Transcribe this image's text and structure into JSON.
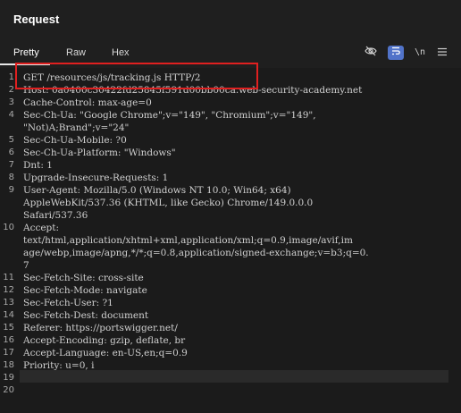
{
  "panel": {
    "title": "Request"
  },
  "tabs": [
    {
      "label": "Pretty"
    },
    {
      "label": "Raw"
    },
    {
      "label": "Hex"
    }
  ],
  "toolbar": {
    "hide_icon": "eye-slash-icon",
    "wrap_icon": "word-wrap-icon",
    "newline_label": "\\n",
    "menu_icon": "hamburger-menu-icon"
  },
  "lines": [
    {
      "n": "1",
      "text": "GET /resources/js/tracking.js HTTP/2"
    },
    {
      "n": "2",
      "text": "Host: 0a0400c30422fd25845f591d00bb00ca.web-security-academy.net"
    },
    {
      "n": "3",
      "text": "Cache-Control: max-age=0"
    },
    {
      "n": "4",
      "text": "Sec-Ch-Ua: \"Google Chrome\";v=\"149\", \"Chromium\";v=\"149\","
    },
    {
      "n": "",
      "text": "\"Not)A;Brand\";v=\"24\""
    },
    {
      "n": "5",
      "text": "Sec-Ch-Ua-Mobile: ?0"
    },
    {
      "n": "6",
      "text": "Sec-Ch-Ua-Platform: \"Windows\""
    },
    {
      "n": "7",
      "text": "Dnt: 1"
    },
    {
      "n": "8",
      "text": "Upgrade-Insecure-Requests: 1"
    },
    {
      "n": "9",
      "text": "User-Agent: Mozilla/5.0 (Windows NT 10.0; Win64; x64)"
    },
    {
      "n": "",
      "text": "AppleWebKit/537.36 (KHTML, like Gecko) Chrome/149.0.0.0"
    },
    {
      "n": "",
      "text": "Safari/537.36"
    },
    {
      "n": "10",
      "text": "Accept:"
    },
    {
      "n": "",
      "text": "text/html,application/xhtml+xml,application/xml;q=0.9,image/avif,im"
    },
    {
      "n": "",
      "text": "age/webp,image/apng,*/*;q=0.8,application/signed-exchange;v=b3;q=0."
    },
    {
      "n": "",
      "text": "7"
    },
    {
      "n": "11",
      "text": "Sec-Fetch-Site: cross-site"
    },
    {
      "n": "12",
      "text": "Sec-Fetch-Mode: navigate"
    },
    {
      "n": "13",
      "text": "Sec-Fetch-User: ?1"
    },
    {
      "n": "14",
      "text": "Sec-Fetch-Dest: document"
    },
    {
      "n": "15",
      "text": "Referer: https://portswigger.net/"
    },
    {
      "n": "16",
      "text": "Accept-Encoding: gzip, deflate, br"
    },
    {
      "n": "17",
      "text": "Accept-Language: en-US,en;q=0.9"
    },
    {
      "n": "18",
      "text": "Priority: u=0, i"
    },
    {
      "n": "19",
      "text": ""
    },
    {
      "n": "20",
      "text": ""
    }
  ],
  "colors": {
    "background": "#1f1f1f",
    "highlight_border": "#e02020",
    "wrap_button": "#5173c9"
  }
}
